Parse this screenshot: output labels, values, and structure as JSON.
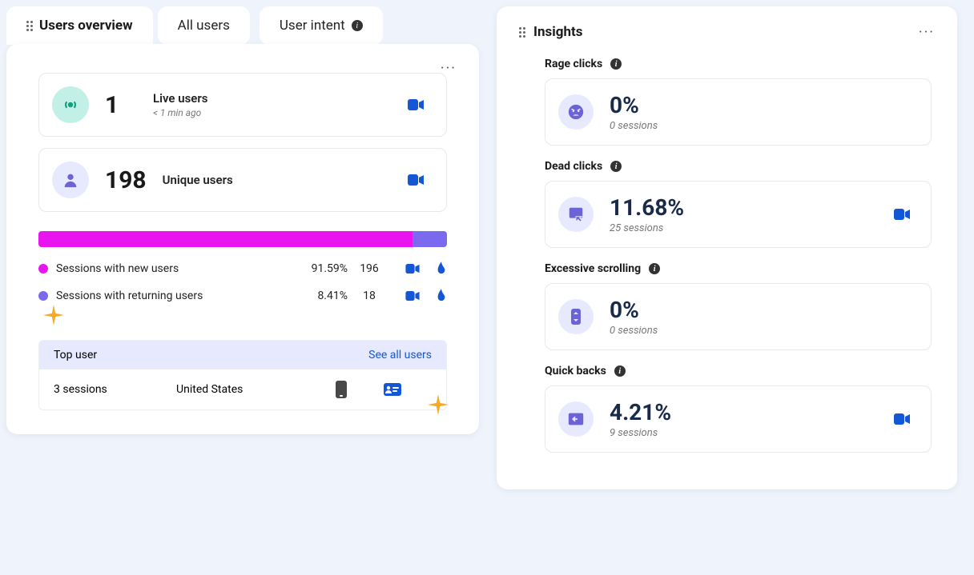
{
  "tabs": {
    "overview": "Users overview",
    "all": "All users",
    "intent": "User intent"
  },
  "live": {
    "value": "1",
    "label": "Live users",
    "sub": "< 1 min ago"
  },
  "unique": {
    "value": "198",
    "label": "Unique users"
  },
  "sessions": {
    "new": {
      "label": "Sessions with new users",
      "pct": "91.59%",
      "count": "196"
    },
    "ret": {
      "label": "Sessions with returning users",
      "pct": "8.41%",
      "count": "18"
    }
  },
  "progress": {
    "seg1_width": "91.59%",
    "seg2_width": "8.41%"
  },
  "top_user": {
    "title": "Top user",
    "see_all": "See all users",
    "sessions": "3 sessions",
    "country": "United States"
  },
  "insights": {
    "title": "Insights",
    "rage": {
      "title": "Rage clicks",
      "value": "0%",
      "sub": "0 sessions",
      "cam": false
    },
    "dead": {
      "title": "Dead clicks",
      "value": "11.68%",
      "sub": "25 sessions",
      "cam": true
    },
    "scroll": {
      "title": "Excessive scrolling",
      "value": "0%",
      "sub": "0 sessions",
      "cam": false
    },
    "quick": {
      "title": "Quick backs",
      "value": "4.21%",
      "sub": "9 sessions",
      "cam": true
    }
  },
  "chart_data": {
    "type": "bar",
    "categories": [
      "Sessions with new users",
      "Sessions with returning users"
    ],
    "values": [
      196,
      18
    ],
    "percentages": [
      91.59,
      8.41
    ],
    "title": "",
    "xlabel": "",
    "ylabel": ""
  }
}
